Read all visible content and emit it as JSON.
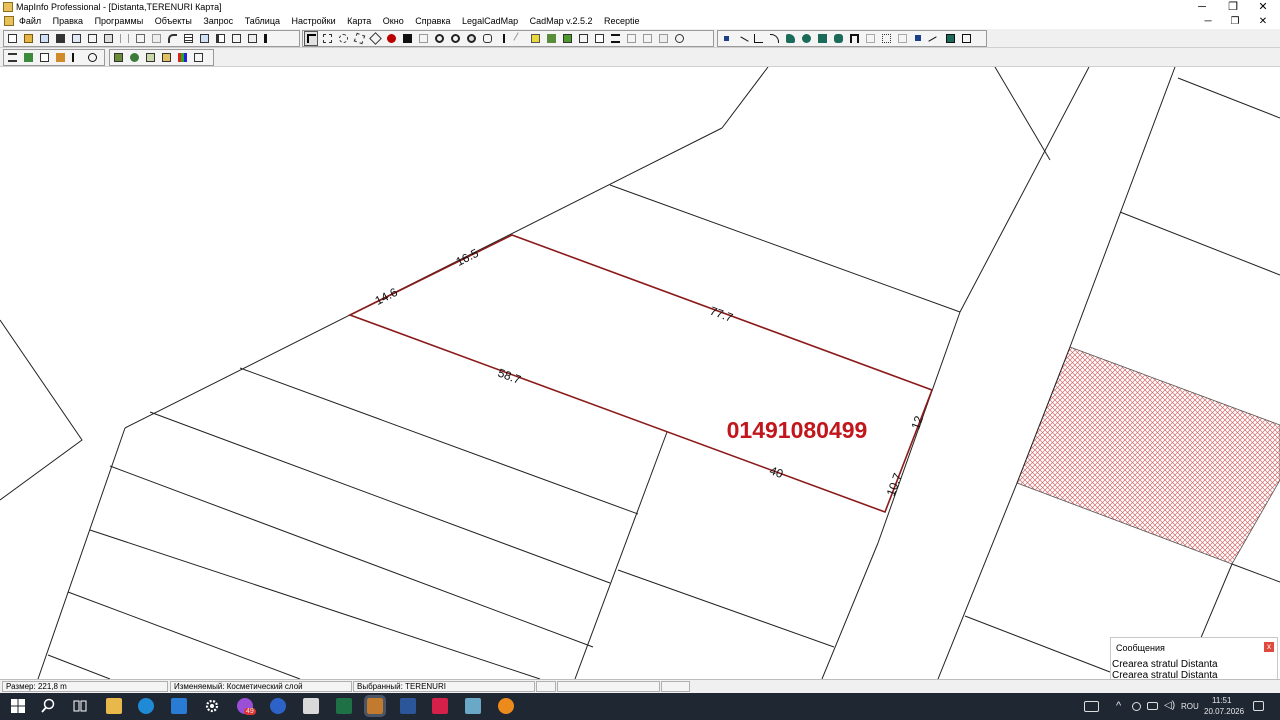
{
  "window": {
    "title": "MapInfo Professional - [Distanta,TERENURI Карта]",
    "controls": [
      "─",
      "❐",
      "✕"
    ]
  },
  "menu": {
    "items": [
      "Файл",
      "Правка",
      "Программы",
      "Объекты",
      "Запрос",
      "Таблица",
      "Настройки",
      "Карта",
      "Окно",
      "Справка",
      "LegalCadMap",
      "CadMap v.2.5.2",
      "Receptie"
    ],
    "doc_controls": [
      "─",
      "❐",
      "✕"
    ]
  },
  "map": {
    "parcel_id": "01491080499",
    "parcel_color": "#8b1a1a",
    "id_color": "#c0161c",
    "dimensions": {
      "left_short": "14.6",
      "top_short": "16.5",
      "top_long": "77.7",
      "bottom_long": "58.7",
      "bottom_short": "40",
      "right_upper": "12",
      "right_lower": "10.7"
    }
  },
  "messages": {
    "title": "Сообщения",
    "lines": [
      "Crearea stratul Distanta",
      "Crearea stratul Distanta"
    ]
  },
  "status": {
    "size": "Размер: 221,8 m",
    "editable": "Изменяемый: Косметический слой",
    "selected": "Выбранный: TERENURI"
  },
  "taskbar": {
    "badge": "49",
    "lang": "ROU",
    "time": "11:51",
    "date": "20.07.2026"
  },
  "colors": {
    "taskbar": "#1f2733",
    "hatch": "#d46a6a"
  }
}
